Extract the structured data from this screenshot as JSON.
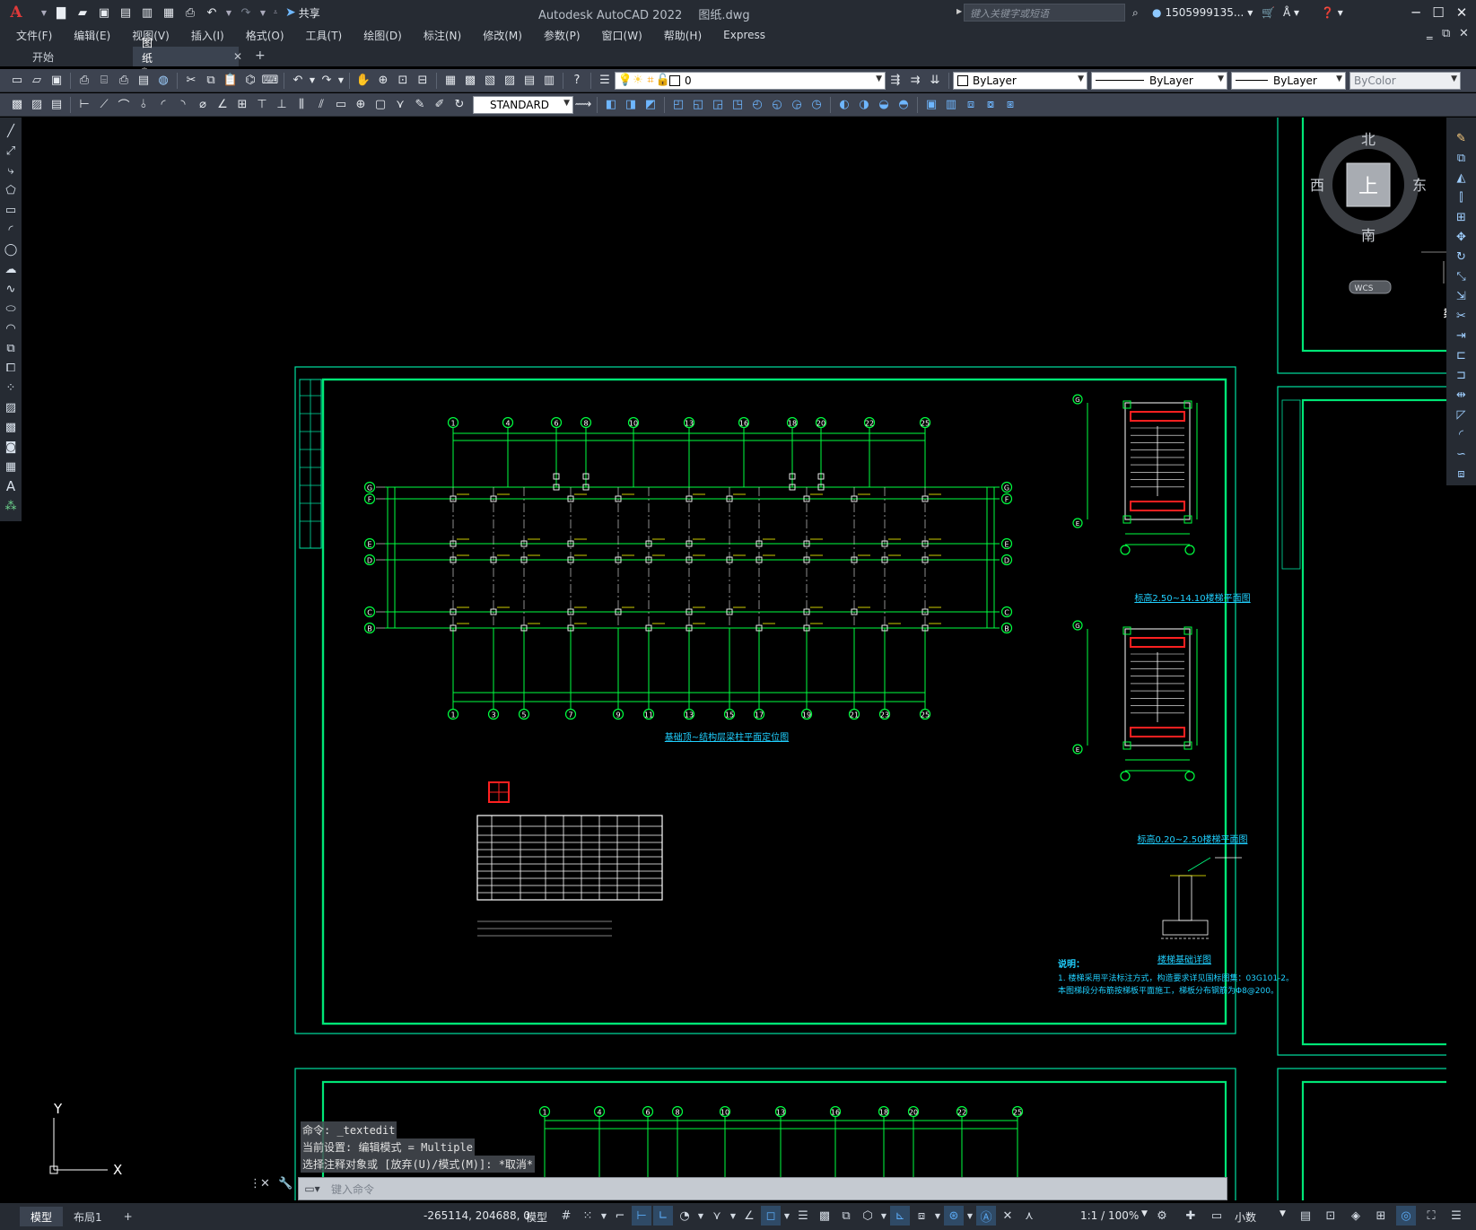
{
  "app": {
    "title": "Autodesk AutoCAD 2022",
    "filename": "图纸.dwg",
    "share_label": "共享",
    "search_placeholder": "键入关键字或短语",
    "user": "1505999135..."
  },
  "menu": [
    "文件(F)",
    "编辑(E)",
    "视图(V)",
    "插入(I)",
    "格式(O)",
    "工具(T)",
    "绘图(D)",
    "标注(N)",
    "修改(M)",
    "参数(P)",
    "窗口(W)",
    "帮助(H)",
    "Express"
  ],
  "tabs": [
    {
      "label": "开始"
    },
    {
      "label": "图纸*"
    }
  ],
  "toolbar": {
    "layer_value": "0",
    "color": "ByLayer",
    "linetype": "ByLayer",
    "lineweight": "ByLayer",
    "plotstyle": "ByColor",
    "textstyle": "STANDARD"
  },
  "viewcube": {
    "north": "北",
    "south": "南",
    "east": "东",
    "west": "西",
    "face": "上",
    "wcs": "WCS"
  },
  "ucs": {
    "x": "X",
    "y": "Y"
  },
  "command": {
    "history": [
      "命令: _textedit",
      "当前设置: 编辑模式 = Multiple",
      "选择注释对象或 [放弃(U)/模式(M)]: *取消*"
    ],
    "placeholder": "键入命令"
  },
  "status": {
    "tabs": [
      "模型",
      "布局1"
    ],
    "coords": "-265114, 204688, 0",
    "model_space": "模型",
    "scale": "1:1 / 100%",
    "units": "小数"
  },
  "drawing": {
    "top_axes": [
      "1",
      "4",
      "6",
      "8",
      "10",
      "13",
      "16",
      "18",
      "20",
      "22",
      "25"
    ],
    "bottom_axes": [
      "1",
      "3",
      "5",
      "7",
      "9",
      "11",
      "13",
      "15",
      "17",
      "19",
      "21",
      "23",
      "25"
    ],
    "row_axes": [
      "G",
      "F",
      "E",
      "D",
      "C",
      "B"
    ],
    "plan_title": "基础顶~结构层梁柱平面定位图",
    "stair1_title": "标高2.50~14.10楼梯平面图",
    "stair2_title": "标高0.20~2.50楼梯平面图",
    "detail_title": "楼梯基础详图",
    "notes_title": "说明：",
    "notes": [
      "1. 楼梯采用平法标注方式，构造要求详见国标图集：03G101-2。",
      "本图梯段分布筋按梯板平面施工，梯板分布钢筋为Φ8@200。"
    ],
    "bottom_axes2": [
      "1",
      "4",
      "6",
      "8",
      "10",
      "13",
      "16",
      "18",
      "20",
      "22",
      "25"
    ]
  }
}
